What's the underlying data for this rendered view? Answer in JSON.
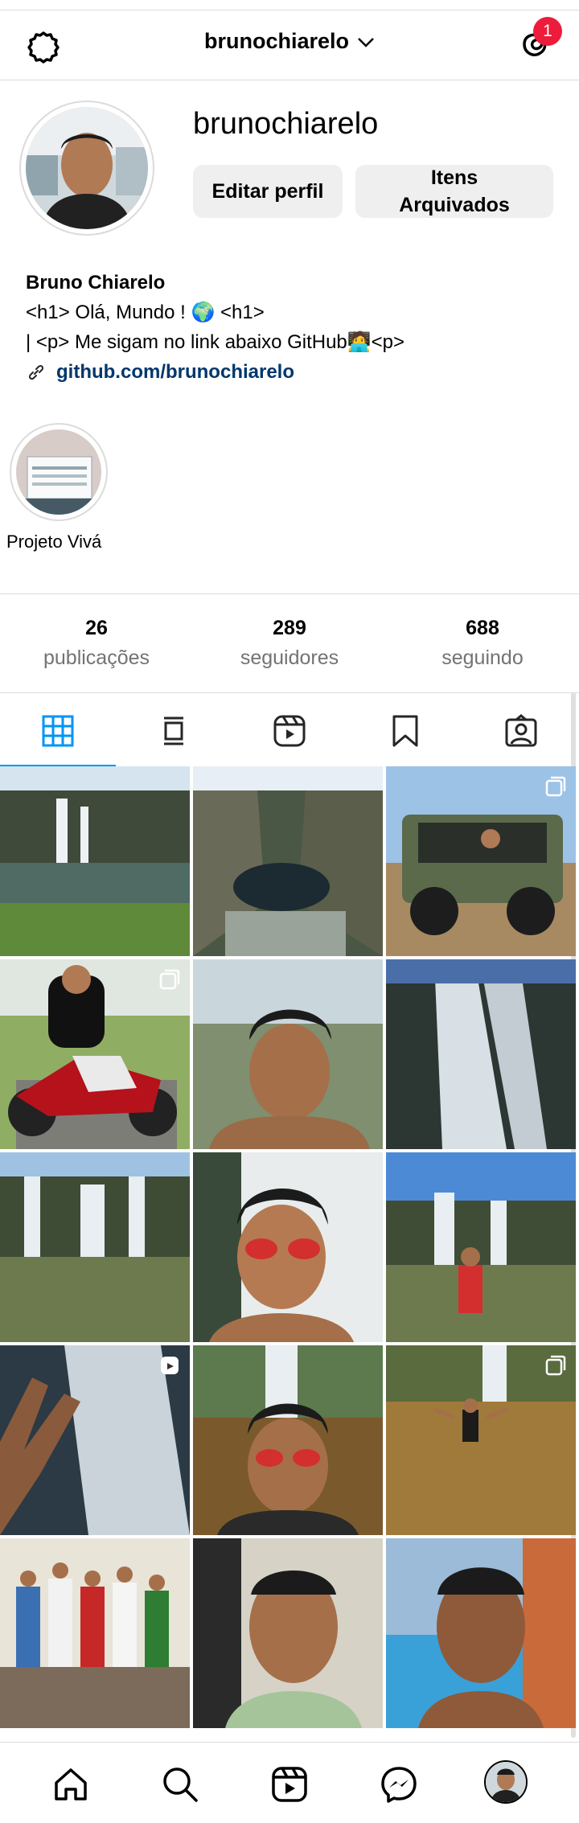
{
  "header": {
    "username": "brunochiarelo",
    "notification_count": "1",
    "icons": [
      "gear-icon",
      "chevron-down-icon",
      "threads-icon"
    ]
  },
  "profile": {
    "username": "brunochiarelo",
    "edit_button": "Editar perfil",
    "archive_button": "Itens Arquivados",
    "full_name": "Bruno Chiarelo",
    "bio_line1": "<h1> Olá, Mundo ! 🌍 <h1>",
    "bio_line2": "| <p> Me sigam no link abaixo GitHub🧑‍💻<p>",
    "link": "github.com/brunochiarelo"
  },
  "highlights": [
    {
      "label": "Projeto Vivá"
    }
  ],
  "stats": {
    "posts_count": "26",
    "posts_label": "publicações",
    "followers_count": "289",
    "followers_label": "seguidores",
    "following_count": "688",
    "following_label": "seguindo"
  },
  "tabs": [
    "grid-icon",
    "feed-icon",
    "reels-icon",
    "saved-icon",
    "tagged-icon"
  ],
  "posts": [
    {
      "scene": "waterfall",
      "mark": ""
    },
    {
      "scene": "canyon",
      "mark": ""
    },
    {
      "scene": "buggy",
      "mark": "carousel"
    },
    {
      "scene": "moto",
      "mark": "carousel"
    },
    {
      "scene": "selfie-falls",
      "mark": ""
    },
    {
      "scene": "falls-dark",
      "mark": ""
    },
    {
      "scene": "waterfall-wide",
      "mark": ""
    },
    {
      "scene": "selfie-sunglasses",
      "mark": ""
    },
    {
      "scene": "falls-person",
      "mark": ""
    },
    {
      "scene": "hand-falls",
      "mark": "reel"
    },
    {
      "scene": "selfie-river",
      "mark": ""
    },
    {
      "scene": "river-person",
      "mark": "carousel"
    },
    {
      "scene": "family",
      "mark": ""
    },
    {
      "scene": "selfie-home",
      "mark": ""
    },
    {
      "scene": "selfie-pool",
      "mark": ""
    }
  ],
  "colors": {
    "accent": "#0095f6",
    "badge": "#ed1c3a",
    "link": "#00376b",
    "button_bg": "#efefef"
  },
  "bottom_nav": [
    "home-icon",
    "search-icon",
    "reels-icon",
    "messenger-icon",
    "profile-avatar"
  ]
}
